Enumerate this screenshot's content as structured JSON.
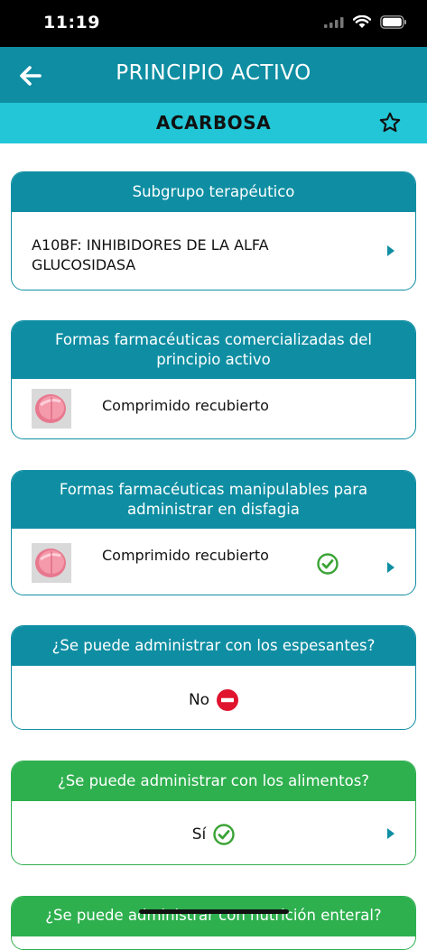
{
  "status": {
    "time": "11:19"
  },
  "nav": {
    "title": "PRINCIPIO ACTIVO"
  },
  "drug": {
    "name": "ACARBOSA"
  },
  "subgroup": {
    "header": "Subgrupo terapéutico",
    "line1": "A10BF: INHIBIDORES DE LA ALFA",
    "line2": "GLUCOSIDASA"
  },
  "commercial_forms": {
    "header_line1": "Formas farmacéuticas comercializadas del",
    "header_line2": "principio activo",
    "item": "Comprimido recubierto"
  },
  "manipulable_forms": {
    "header_line1": "Formas farmacéuticas manipulables para",
    "header_line2": "administrar en disfagia",
    "item": "Comprimido recubierto"
  },
  "thickeners": {
    "header": "¿Se puede administrar con los espesantes?",
    "answer": "No"
  },
  "food": {
    "header": "¿Se puede administrar con los alimentos?",
    "answer": "Sí"
  },
  "enteral": {
    "header": "¿Se puede administrar con nutrición enteral?"
  },
  "colors": {
    "teal": "#0f8ea3",
    "cyan": "#22c6d6",
    "green": "#2fb04f",
    "red": "#e0142e"
  },
  "icons": [
    "back-arrow-icon",
    "star-outline-icon",
    "chevron-right-icon",
    "check-circle-icon",
    "no-entry-icon",
    "pill-icon",
    "wifi-icon",
    "battery-icon",
    "signal-icon"
  ]
}
